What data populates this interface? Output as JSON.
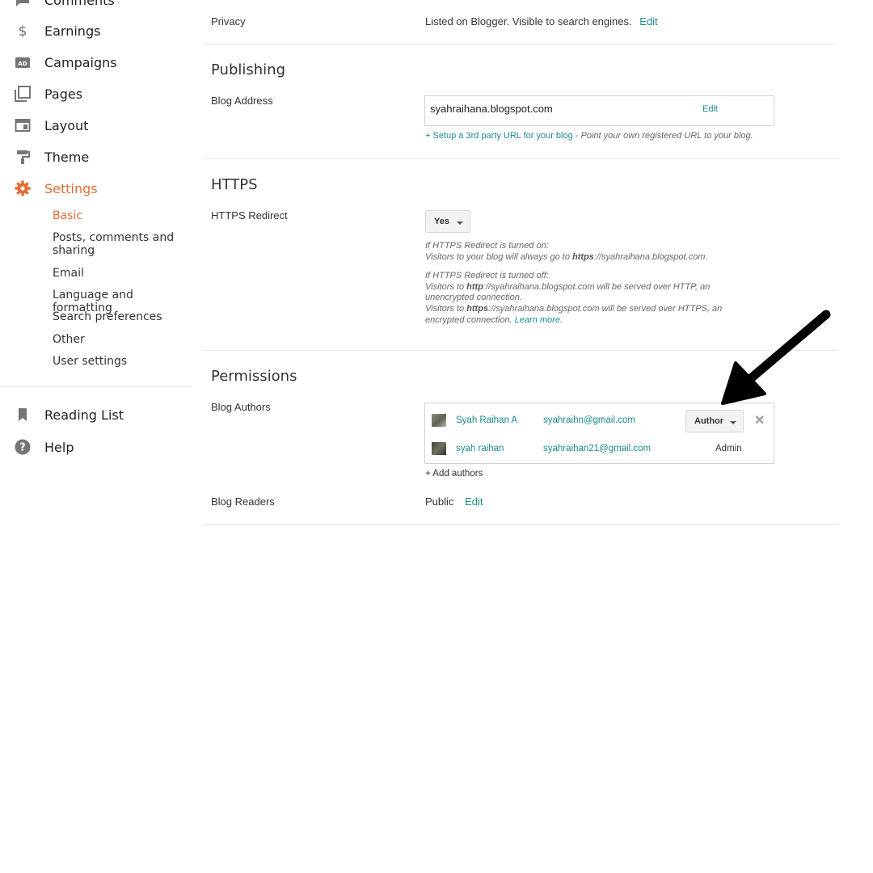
{
  "sidebar": {
    "items": [
      {
        "label": "Comments",
        "icon": "comment-icon"
      },
      {
        "label": "Earnings",
        "icon": "dollar-icon"
      },
      {
        "label": "Campaigns",
        "icon": "ad-icon"
      },
      {
        "label": "Pages",
        "icon": "pages-icon"
      },
      {
        "label": "Layout",
        "icon": "layout-icon"
      },
      {
        "label": "Theme",
        "icon": "paint-roller-icon"
      },
      {
        "label": "Settings",
        "icon": "gear-icon",
        "active": true
      }
    ],
    "settings_sub": [
      {
        "label": "Basic",
        "active": true
      },
      {
        "label": "Posts, comments and sharing"
      },
      {
        "label": "Email"
      },
      {
        "label": "Language and formatting"
      },
      {
        "label": "Search preferences"
      },
      {
        "label": "Other"
      },
      {
        "label": "User settings"
      }
    ],
    "footer_items": [
      {
        "label": "Reading List",
        "icon": "bookmark-icon"
      },
      {
        "label": "Help",
        "icon": "help-icon"
      }
    ]
  },
  "privacy": {
    "label": "Privacy",
    "value": "Listed on Blogger. Visible to search engines.",
    "edit": "Edit"
  },
  "publishing": {
    "title": "Publishing",
    "blog_address_label": "Blog Address",
    "blog_address": "syahraihana.blogspot.com",
    "edit": "Edit",
    "third_party_link": "+ Setup a 3rd party URL for your blog",
    "third_party_hint": " - Point your own registered URL to your blog."
  },
  "https": {
    "title": "HTTPS",
    "redirect_label": "HTTPS Redirect",
    "redirect_value": "Yes",
    "on_heading": "If HTTPS Redirect is turned on:",
    "on_pre": "Visitors to your blog will always go to ",
    "on_bold": "https",
    "on_post": "://syahraihana.blogspot.com.",
    "off_heading": "If HTTPS Redirect is turned off:",
    "off1_pre": "Visitors to ",
    "off1_bold": "http",
    "off1_post": "://syahraihana.blogspot.com will be served over HTTP, an",
    "off1_line2": "unencrypted connection.",
    "off2_pre": "Visitors to ",
    "off2_bold": "https",
    "off2_post": "://syahraihana.blogspot.com will be served over HTTPS, an",
    "off2_line2": "encrypted connection. ",
    "learn_more": "Learn more."
  },
  "permissions": {
    "title": "Permissions",
    "authors_label": "Blog Authors",
    "authors": [
      {
        "name": "Syah Raihan A",
        "email": "syahraihn@gmail.com",
        "role": "Author"
      },
      {
        "name": "syah raihan",
        "email": "syahraihan21@gmail.com",
        "role": "Admin"
      }
    ],
    "add_authors": "+ Add authors",
    "readers_label": "Blog Readers",
    "readers_value": "Public",
    "readers_edit": "Edit"
  },
  "colors": {
    "accent": "#e46b33",
    "link": "#1a8a8c"
  }
}
